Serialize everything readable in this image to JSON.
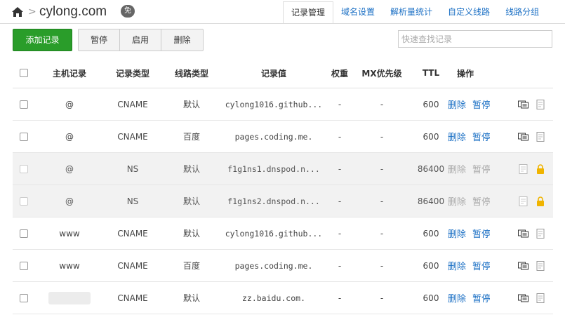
{
  "header": {
    "domain": "cylong.com",
    "badge": "免",
    "tabs": [
      "记录管理",
      "域名设置",
      "解析量统计",
      "自定义线路",
      "线路分组"
    ],
    "active_tab": 0
  },
  "toolbar": {
    "add_label": "添加记录",
    "pause_label": "暂停",
    "enable_label": "启用",
    "delete_label": "删除",
    "search_placeholder": "快速查找记录"
  },
  "table": {
    "columns": [
      "主机记录",
      "记录类型",
      "线路类型",
      "记录值",
      "权重",
      "MX优先级",
      "TTL",
      "操作"
    ],
    "rows": [
      {
        "host": "@",
        "type": "CNAME",
        "line": "默认",
        "value": "cylong1016.github...",
        "weight": "-",
        "mx": "-",
        "ttl": "600",
        "op_delete": "删除",
        "op_pause": "暂停",
        "disabled": false,
        "locked": false
      },
      {
        "host": "@",
        "type": "CNAME",
        "line": "百度",
        "value": "pages.coding.me.",
        "weight": "-",
        "mx": "-",
        "ttl": "600",
        "op_delete": "删除",
        "op_pause": "暂停",
        "disabled": false,
        "locked": false
      },
      {
        "host": "@",
        "type": "NS",
        "line": "默认",
        "value": "f1g1ns1.dnspod.n...",
        "weight": "-",
        "mx": "-",
        "ttl": "86400",
        "op_delete": "删除",
        "op_pause": "暂停",
        "disabled": true,
        "locked": true
      },
      {
        "host": "@",
        "type": "NS",
        "line": "默认",
        "value": "f1g1ns2.dnspod.n...",
        "weight": "-",
        "mx": "-",
        "ttl": "86400",
        "op_delete": "删除",
        "op_pause": "暂停",
        "disabled": true,
        "locked": true
      },
      {
        "host": "www",
        "type": "CNAME",
        "line": "默认",
        "value": "cylong1016.github...",
        "weight": "-",
        "mx": "-",
        "ttl": "600",
        "op_delete": "删除",
        "op_pause": "暂停",
        "disabled": false,
        "locked": false
      },
      {
        "host": "www",
        "type": "CNAME",
        "line": "百度",
        "value": "pages.coding.me.",
        "weight": "-",
        "mx": "-",
        "ttl": "600",
        "op_delete": "删除",
        "op_pause": "暂停",
        "disabled": false,
        "locked": false
      },
      {
        "host": "",
        "type": "CNAME",
        "line": "默认",
        "value": "zz.baidu.com.",
        "weight": "-",
        "mx": "-",
        "ttl": "600",
        "op_delete": "删除",
        "op_pause": "暂停",
        "disabled": false,
        "locked": false
      }
    ]
  },
  "colors": {
    "accent": "#2a9d2a",
    "link": "#1a6fc4",
    "lock": "#f0b400"
  },
  "icons": [
    "home-icon",
    "comment-icon",
    "note-icon",
    "lock-icon"
  ]
}
